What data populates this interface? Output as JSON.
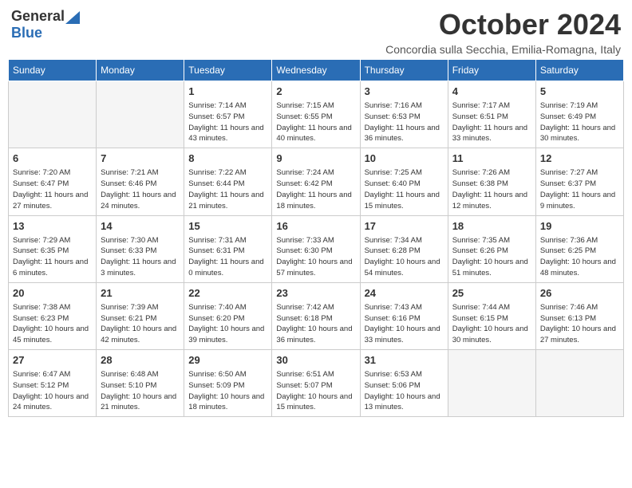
{
  "header": {
    "logo_general": "General",
    "logo_blue": "Blue",
    "month": "October 2024",
    "subtitle": "Concordia sulla Secchia, Emilia-Romagna, Italy"
  },
  "weekdays": [
    "Sunday",
    "Monday",
    "Tuesday",
    "Wednesday",
    "Thursday",
    "Friday",
    "Saturday"
  ],
  "weeks": [
    [
      {
        "day": "",
        "empty": true
      },
      {
        "day": "",
        "empty": true
      },
      {
        "day": "1",
        "sunrise": "Sunrise: 7:14 AM",
        "sunset": "Sunset: 6:57 PM",
        "daylight": "Daylight: 11 hours and 43 minutes."
      },
      {
        "day": "2",
        "sunrise": "Sunrise: 7:15 AM",
        "sunset": "Sunset: 6:55 PM",
        "daylight": "Daylight: 11 hours and 40 minutes."
      },
      {
        "day": "3",
        "sunrise": "Sunrise: 7:16 AM",
        "sunset": "Sunset: 6:53 PM",
        "daylight": "Daylight: 11 hours and 36 minutes."
      },
      {
        "day": "4",
        "sunrise": "Sunrise: 7:17 AM",
        "sunset": "Sunset: 6:51 PM",
        "daylight": "Daylight: 11 hours and 33 minutes."
      },
      {
        "day": "5",
        "sunrise": "Sunrise: 7:19 AM",
        "sunset": "Sunset: 6:49 PM",
        "daylight": "Daylight: 11 hours and 30 minutes."
      }
    ],
    [
      {
        "day": "6",
        "sunrise": "Sunrise: 7:20 AM",
        "sunset": "Sunset: 6:47 PM",
        "daylight": "Daylight: 11 hours and 27 minutes."
      },
      {
        "day": "7",
        "sunrise": "Sunrise: 7:21 AM",
        "sunset": "Sunset: 6:46 PM",
        "daylight": "Daylight: 11 hours and 24 minutes."
      },
      {
        "day": "8",
        "sunrise": "Sunrise: 7:22 AM",
        "sunset": "Sunset: 6:44 PM",
        "daylight": "Daylight: 11 hours and 21 minutes."
      },
      {
        "day": "9",
        "sunrise": "Sunrise: 7:24 AM",
        "sunset": "Sunset: 6:42 PM",
        "daylight": "Daylight: 11 hours and 18 minutes."
      },
      {
        "day": "10",
        "sunrise": "Sunrise: 7:25 AM",
        "sunset": "Sunset: 6:40 PM",
        "daylight": "Daylight: 11 hours and 15 minutes."
      },
      {
        "day": "11",
        "sunrise": "Sunrise: 7:26 AM",
        "sunset": "Sunset: 6:38 PM",
        "daylight": "Daylight: 11 hours and 12 minutes."
      },
      {
        "day": "12",
        "sunrise": "Sunrise: 7:27 AM",
        "sunset": "Sunset: 6:37 PM",
        "daylight": "Daylight: 11 hours and 9 minutes."
      }
    ],
    [
      {
        "day": "13",
        "sunrise": "Sunrise: 7:29 AM",
        "sunset": "Sunset: 6:35 PM",
        "daylight": "Daylight: 11 hours and 6 minutes."
      },
      {
        "day": "14",
        "sunrise": "Sunrise: 7:30 AM",
        "sunset": "Sunset: 6:33 PM",
        "daylight": "Daylight: 11 hours and 3 minutes."
      },
      {
        "day": "15",
        "sunrise": "Sunrise: 7:31 AM",
        "sunset": "Sunset: 6:31 PM",
        "daylight": "Daylight: 11 hours and 0 minutes."
      },
      {
        "day": "16",
        "sunrise": "Sunrise: 7:33 AM",
        "sunset": "Sunset: 6:30 PM",
        "daylight": "Daylight: 10 hours and 57 minutes."
      },
      {
        "day": "17",
        "sunrise": "Sunrise: 7:34 AM",
        "sunset": "Sunset: 6:28 PM",
        "daylight": "Daylight: 10 hours and 54 minutes."
      },
      {
        "day": "18",
        "sunrise": "Sunrise: 7:35 AM",
        "sunset": "Sunset: 6:26 PM",
        "daylight": "Daylight: 10 hours and 51 minutes."
      },
      {
        "day": "19",
        "sunrise": "Sunrise: 7:36 AM",
        "sunset": "Sunset: 6:25 PM",
        "daylight": "Daylight: 10 hours and 48 minutes."
      }
    ],
    [
      {
        "day": "20",
        "sunrise": "Sunrise: 7:38 AM",
        "sunset": "Sunset: 6:23 PM",
        "daylight": "Daylight: 10 hours and 45 minutes."
      },
      {
        "day": "21",
        "sunrise": "Sunrise: 7:39 AM",
        "sunset": "Sunset: 6:21 PM",
        "daylight": "Daylight: 10 hours and 42 minutes."
      },
      {
        "day": "22",
        "sunrise": "Sunrise: 7:40 AM",
        "sunset": "Sunset: 6:20 PM",
        "daylight": "Daylight: 10 hours and 39 minutes."
      },
      {
        "day": "23",
        "sunrise": "Sunrise: 7:42 AM",
        "sunset": "Sunset: 6:18 PM",
        "daylight": "Daylight: 10 hours and 36 minutes."
      },
      {
        "day": "24",
        "sunrise": "Sunrise: 7:43 AM",
        "sunset": "Sunset: 6:16 PM",
        "daylight": "Daylight: 10 hours and 33 minutes."
      },
      {
        "day": "25",
        "sunrise": "Sunrise: 7:44 AM",
        "sunset": "Sunset: 6:15 PM",
        "daylight": "Daylight: 10 hours and 30 minutes."
      },
      {
        "day": "26",
        "sunrise": "Sunrise: 7:46 AM",
        "sunset": "Sunset: 6:13 PM",
        "daylight": "Daylight: 10 hours and 27 minutes."
      }
    ],
    [
      {
        "day": "27",
        "sunrise": "Sunrise: 6:47 AM",
        "sunset": "Sunset: 5:12 PM",
        "daylight": "Daylight: 10 hours and 24 minutes."
      },
      {
        "day": "28",
        "sunrise": "Sunrise: 6:48 AM",
        "sunset": "Sunset: 5:10 PM",
        "daylight": "Daylight: 10 hours and 21 minutes."
      },
      {
        "day": "29",
        "sunrise": "Sunrise: 6:50 AM",
        "sunset": "Sunset: 5:09 PM",
        "daylight": "Daylight: 10 hours and 18 minutes."
      },
      {
        "day": "30",
        "sunrise": "Sunrise: 6:51 AM",
        "sunset": "Sunset: 5:07 PM",
        "daylight": "Daylight: 10 hours and 15 minutes."
      },
      {
        "day": "31",
        "sunrise": "Sunrise: 6:53 AM",
        "sunset": "Sunset: 5:06 PM",
        "daylight": "Daylight: 10 hours and 13 minutes."
      },
      {
        "day": "",
        "empty": true
      },
      {
        "day": "",
        "empty": true
      }
    ]
  ]
}
